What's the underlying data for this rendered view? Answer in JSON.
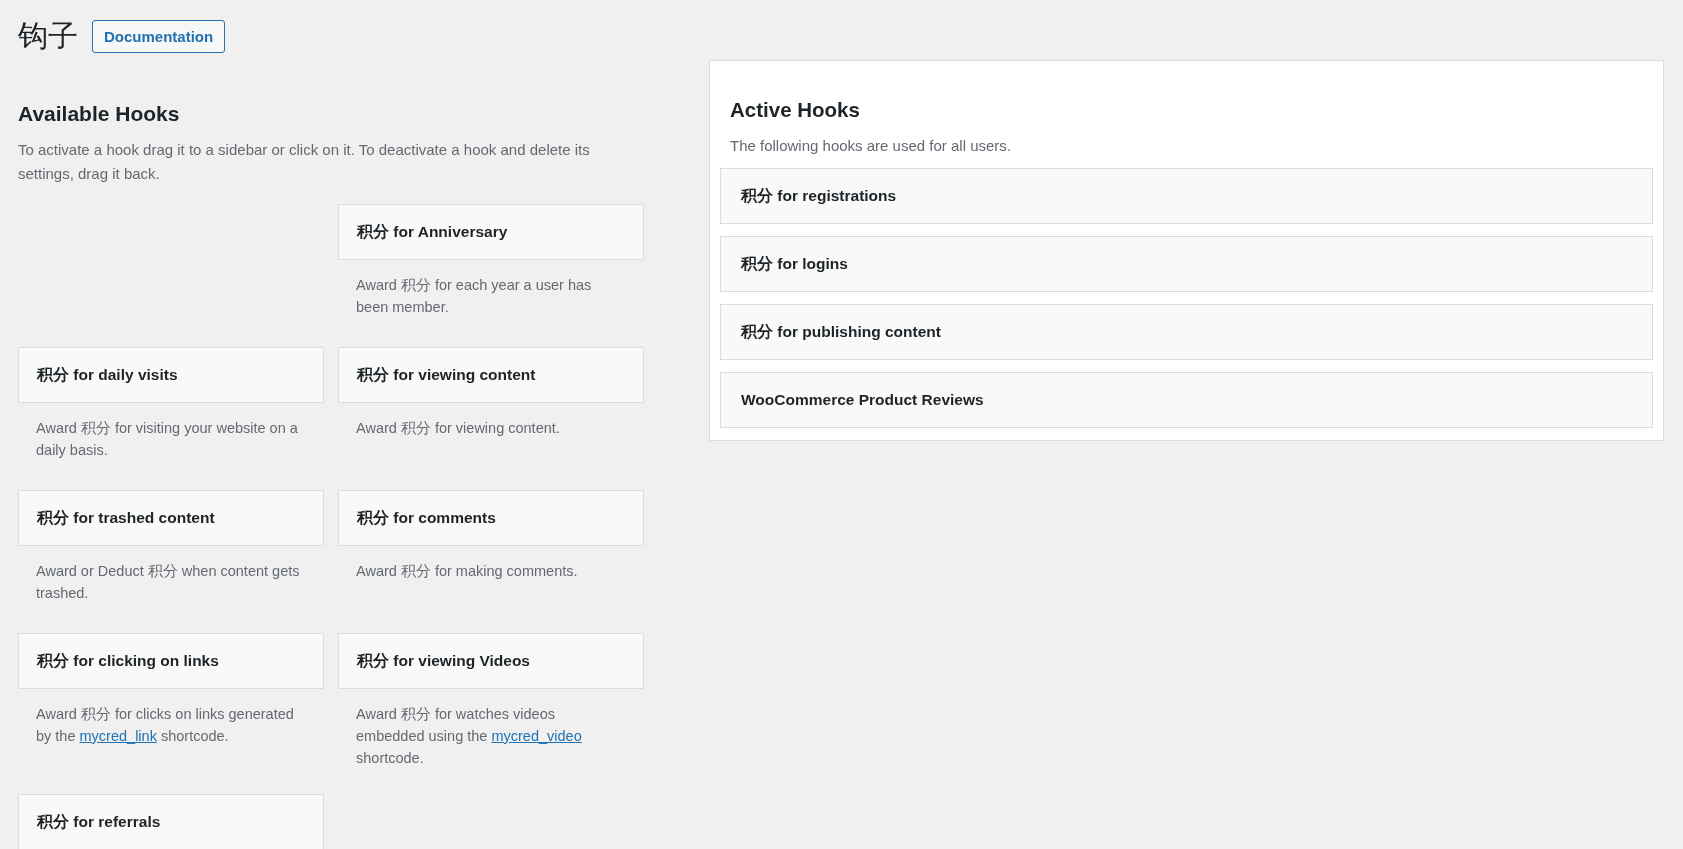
{
  "page_title": "钩子",
  "documentation_button": "Documentation",
  "available": {
    "heading": "Available Hooks",
    "intro": "To activate a hook drag it to a sidebar or click on it. To deactivate a hook and delete its settings, drag it back.",
    "hooks": [
      {
        "title": "积分 for Anniversary",
        "description": [
          {
            "kind": "text",
            "text": "Award 积分 for each year a user has been member."
          }
        ]
      },
      {
        "title": "积分 for daily visits",
        "description": [
          {
            "kind": "text",
            "text": "Award 积分 for visiting your website on a daily basis."
          }
        ]
      },
      {
        "title": "积分 for viewing content",
        "description": [
          {
            "kind": "text",
            "text": "Award 积分 for viewing content."
          }
        ]
      },
      {
        "title": "积分 for trashed content",
        "description": [
          {
            "kind": "text",
            "text": "Award or Deduct 积分 when content gets trashed."
          }
        ]
      },
      {
        "title": "积分 for comments",
        "description": [
          {
            "kind": "text",
            "text": "Award 积分 for making comments."
          }
        ]
      },
      {
        "title": "积分 for clicking on links",
        "description": [
          {
            "kind": "text",
            "text": "Award 积分 for clicks on links generated by the "
          },
          {
            "kind": "link",
            "text": "mycred_link"
          },
          {
            "kind": "text",
            "text": " shortcode."
          }
        ]
      },
      {
        "title": "积分 for viewing Videos",
        "description": [
          {
            "kind": "text",
            "text": "Award 积分 for watches videos embedded using the "
          },
          {
            "kind": "link",
            "text": "mycred_video"
          },
          {
            "kind": "text",
            "text": " shortcode."
          }
        ]
      },
      {
        "title": "积分 for referrals"
      }
    ]
  },
  "active": {
    "heading": "Active Hooks",
    "intro": "The following hooks are used for all users.",
    "hooks": [
      {
        "title": "积分 for registrations"
      },
      {
        "title": "积分 for logins"
      },
      {
        "title": "积分 for publishing content"
      },
      {
        "title": "WooCommerce Product Reviews"
      }
    ]
  }
}
